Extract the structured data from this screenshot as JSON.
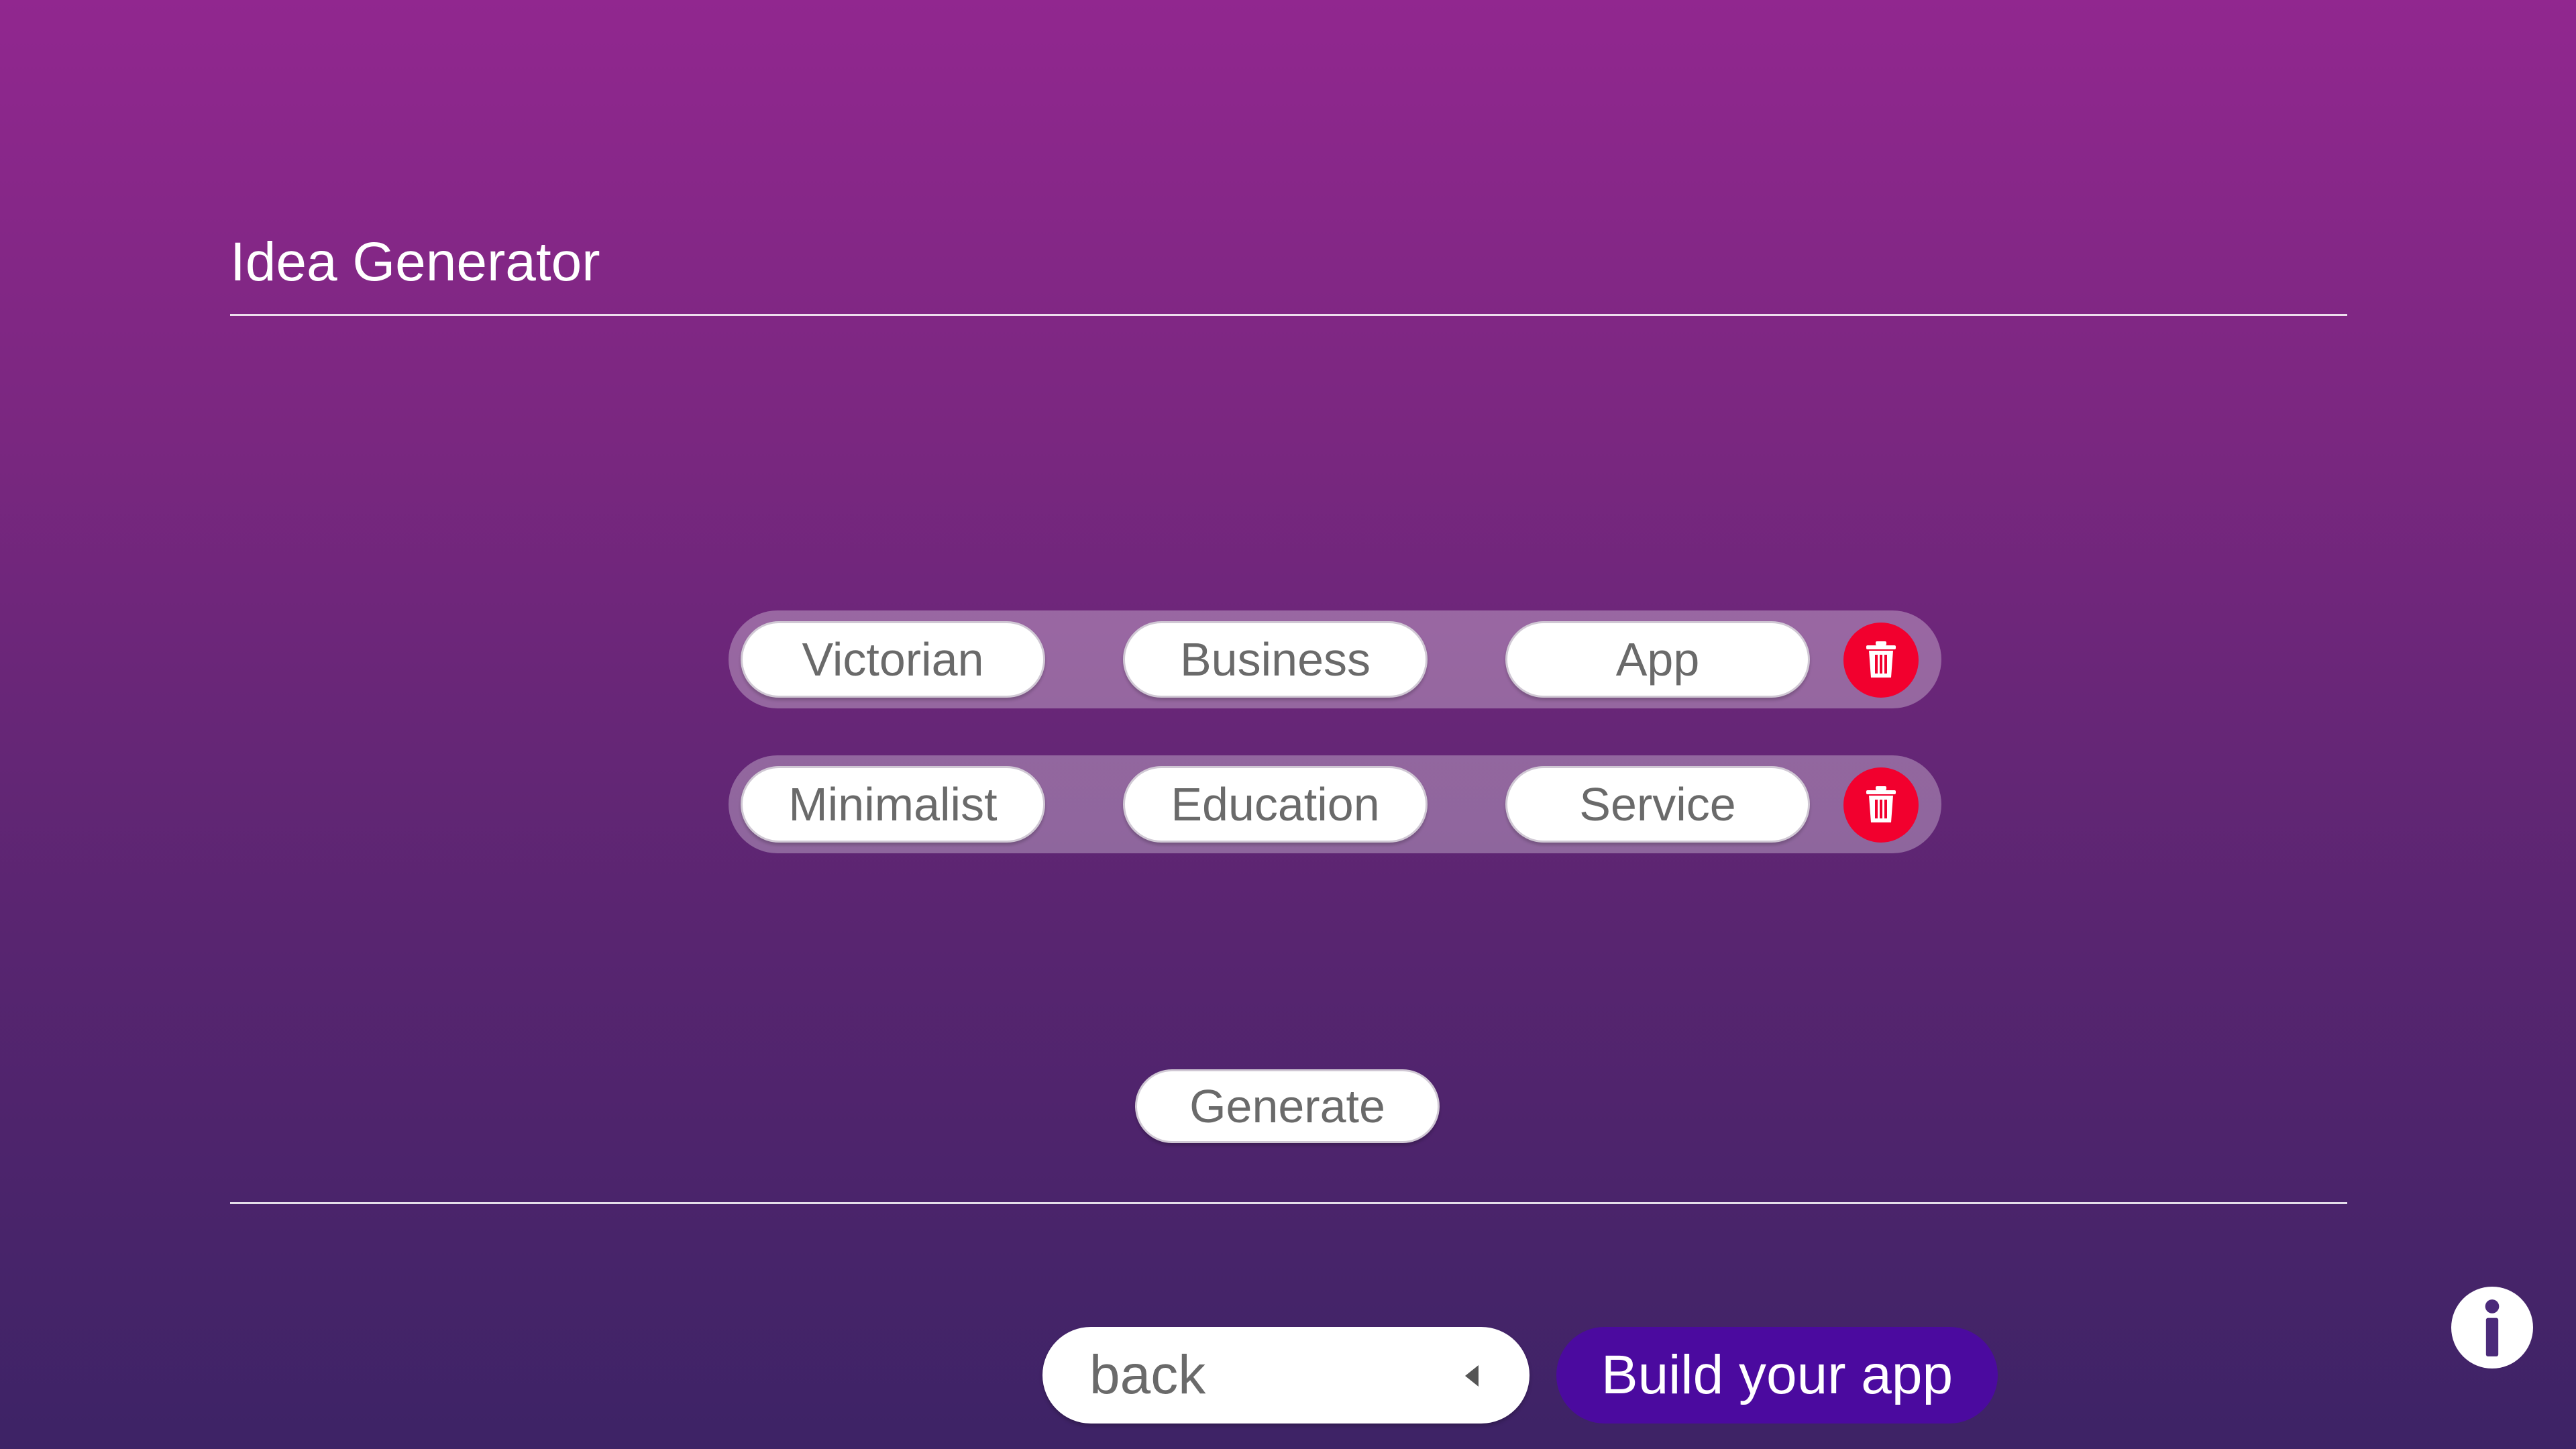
{
  "header": {
    "title": "Idea Generator"
  },
  "idea_rows": [
    {
      "words": [
        "Victorian",
        "Business",
        "App"
      ],
      "delete_icon": "trash-icon"
    },
    {
      "words": [
        "Minimalist",
        "Education",
        "Service"
      ],
      "delete_icon": "trash-icon"
    }
  ],
  "actions": {
    "generate_label": "Generate"
  },
  "footer": {
    "back_label": "back",
    "back_icon": "triangle-left-icon",
    "build_label": "Build your app",
    "info_icon": "info-icon"
  },
  "colors": {
    "background_top": "#91278f",
    "background_bottom": "#3d2366",
    "delete": "#f2002e",
    "build_button": "#4b0a9f",
    "chip_text": "#6a6a6a"
  }
}
